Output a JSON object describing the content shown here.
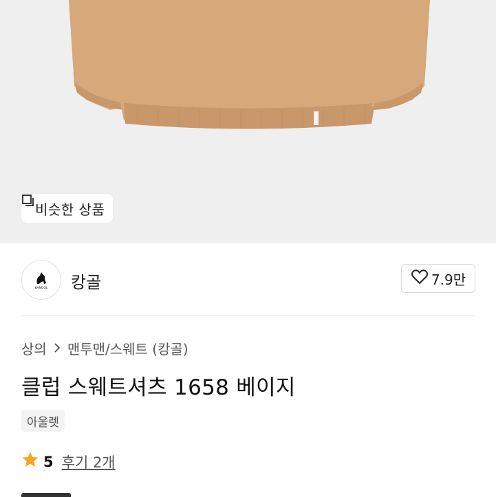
{
  "hero": {
    "similar_button_label": "비슷한 상품",
    "colors": {
      "background": "#efeff0",
      "garment": "#d6a87a",
      "garment_shadow": "#c8976a"
    }
  },
  "brand": {
    "name": "캉골",
    "logo_icon": "kangaroo-logo-icon",
    "logo_text": "KANGOL",
    "likes": "7.9만"
  },
  "breadcrumb": {
    "category": "상의",
    "subcategory": "맨투맨/스웨트 (캉골)"
  },
  "product": {
    "title": "클럽 스웨트셔츠 1658 베이지",
    "tag": "아울렛",
    "rating_score": "5",
    "reviews_label": "후기 2개"
  },
  "icons": {
    "similar": "stacked-squares-icon",
    "like": "heart-outline-icon",
    "breadcrumb_separator": "chevron-right-icon",
    "rating": "star-icon"
  },
  "colors": {
    "star": "#f5a623",
    "text": "#111111",
    "muted": "#555555"
  }
}
